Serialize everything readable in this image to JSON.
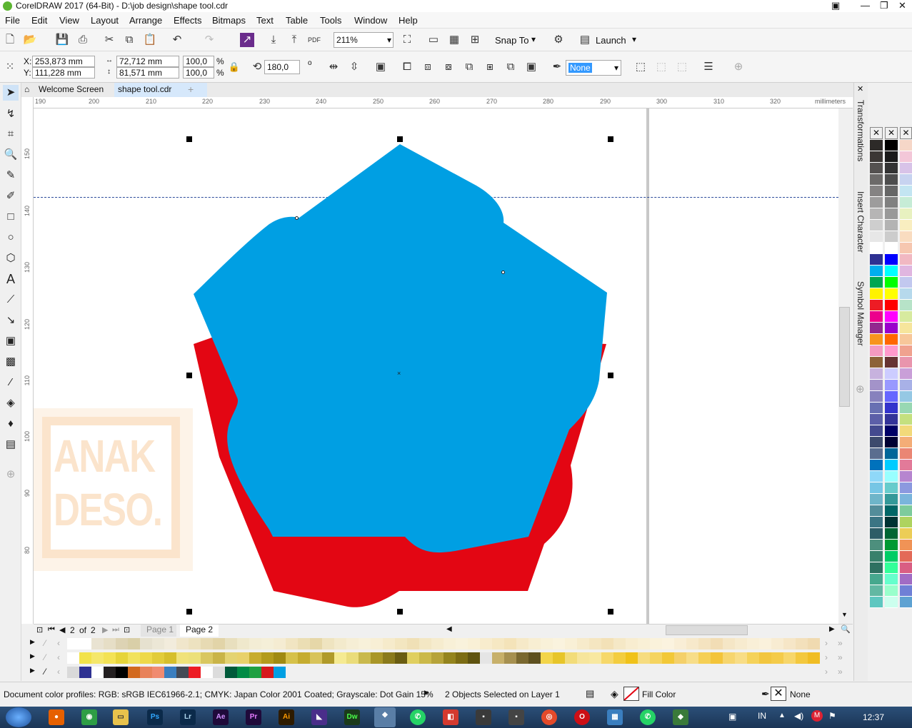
{
  "window": {
    "title": "CorelDRAW 2017 (64-Bit) - D:\\job design\\shape tool.cdr"
  },
  "menu": [
    "File",
    "Edit",
    "View",
    "Layout",
    "Arrange",
    "Effects",
    "Bitmaps",
    "Text",
    "Table",
    "Tools",
    "Window",
    "Help"
  ],
  "standard_toolbar": {
    "zoom_value": "211%",
    "snap_to_label": "Snap To",
    "launch_label": "Launch"
  },
  "property_bar": {
    "x_label": "X:",
    "x_value": "253,873 mm",
    "y_label": "Y:",
    "y_value": "111,228 mm",
    "width_value": "72,712 mm",
    "height_value": "81,571 mm",
    "scale_x": "100,0",
    "scale_y": "100,0",
    "percent": "%",
    "rotation_value": "180,0",
    "degree_symbol": "o",
    "outline_value": "None"
  },
  "doc_tabs": {
    "welcome": "Welcome Screen",
    "file": "shape tool.cdr"
  },
  "ruler": {
    "h_ticks": [
      "190",
      "200",
      "210",
      "220",
      "230",
      "240",
      "250",
      "260",
      "270",
      "280",
      "290",
      "300",
      "310",
      "320"
    ],
    "units": "millimeters",
    "v_ticks": [
      "150",
      "140",
      "130",
      "120",
      "110",
      "100",
      "90",
      "80"
    ]
  },
  "watermark": {
    "line1": "ANAK",
    "line2": "DESO."
  },
  "dockers": [
    "Transformations",
    "Insert Character",
    "Symbol Manager"
  ],
  "page_nav": {
    "current": "2",
    "of": "of",
    "total": "2",
    "page1": "Page 1",
    "page2": "Page 2"
  },
  "status": {
    "color_profiles": "Document color profiles: RGB: sRGB IEC61966-2.1; CMYK: Japan Color 2001 Coated; Grayscale: Dot Gain 15%",
    "selection": "2 Objects Selected on Layer 1",
    "fill_label": "Fill Color",
    "outline_label": "None"
  },
  "taskbar": {
    "language": "IN",
    "time": "12:37"
  },
  "colors": {
    "blue_shape": "#009fe3",
    "red_shape": "#e30613",
    "watermark": "#fcebd8"
  }
}
